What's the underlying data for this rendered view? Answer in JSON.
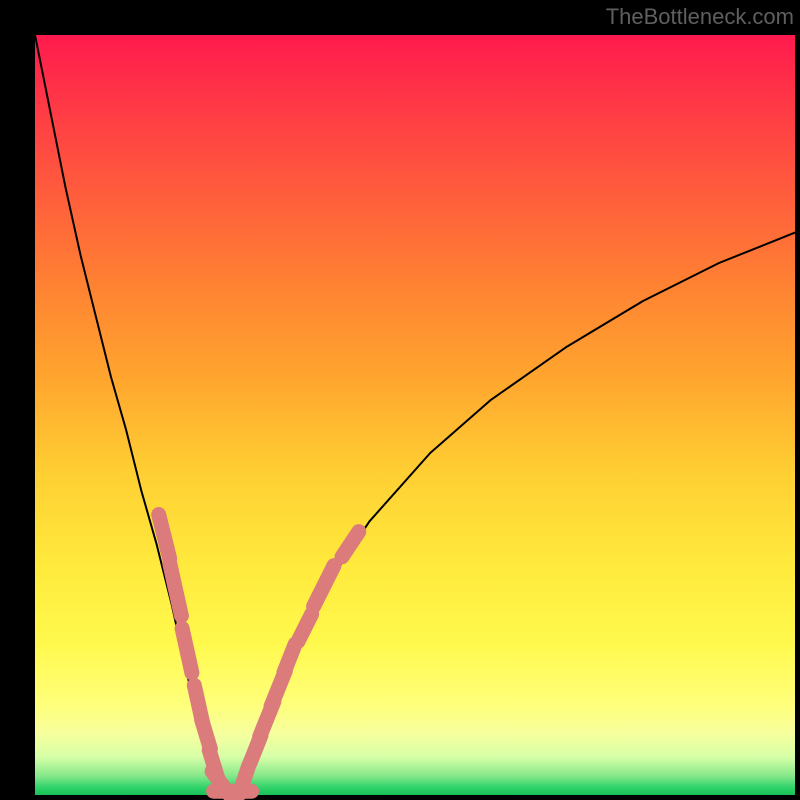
{
  "watermark": "TheBottleneck.com",
  "chart_data": {
    "type": "line",
    "title": "",
    "xlabel": "",
    "ylabel": "",
    "xlim": [
      0,
      100
    ],
    "ylim": [
      0,
      100
    ],
    "background": "rainbow-vertical-gradient",
    "series": [
      {
        "name": "bottleneck-curve",
        "color": "#000000",
        "stroke_width": 2,
        "x": [
          0,
          2,
          4,
          6,
          8,
          10,
          12,
          14,
          16,
          18,
          20,
          22,
          23.5,
          25,
          26,
          27,
          28,
          30,
          32,
          34,
          38,
          44,
          52,
          60,
          70,
          80,
          90,
          100
        ],
        "y": [
          100,
          90,
          80,
          71,
          63,
          55,
          48,
          40,
          33,
          25,
          16,
          7,
          2,
          0,
          0,
          1,
          4,
          9,
          14,
          19,
          27,
          36,
          45,
          52,
          59,
          65,
          70,
          74
        ]
      }
    ],
    "markers": [
      {
        "name": "pink-beads",
        "color": "#db7b7b",
        "shape": "rounded-capsule",
        "points": [
          {
            "x": 17.0,
            "y": 34.0,
            "len": 6
          },
          {
            "x": 18.5,
            "y": 27.0,
            "len": 7
          },
          {
            "x": 20.0,
            "y": 19.0,
            "len": 6
          },
          {
            "x": 21.5,
            "y": 12.0,
            "len": 5
          },
          {
            "x": 22.5,
            "y": 8.0,
            "len": 4
          },
          {
            "x": 23.5,
            "y": 4.0,
            "len": 4
          },
          {
            "x": 24.5,
            "y": 1.5,
            "len": 4
          },
          {
            "x": 26.0,
            "y": 0.5,
            "len": 5
          },
          {
            "x": 27.5,
            "y": 2.0,
            "len": 4
          },
          {
            "x": 29.0,
            "y": 6.0,
            "len": 4
          },
          {
            "x": 30.5,
            "y": 10.0,
            "len": 5
          },
          {
            "x": 32.0,
            "y": 14.0,
            "len": 5
          },
          {
            "x": 33.5,
            "y": 18.0,
            "len": 4
          },
          {
            "x": 35.5,
            "y": 22.0,
            "len": 4
          },
          {
            "x": 38.0,
            "y": 27.5,
            "len": 6
          },
          {
            "x": 41.5,
            "y": 33.0,
            "len": 4
          }
        ]
      }
    ]
  }
}
